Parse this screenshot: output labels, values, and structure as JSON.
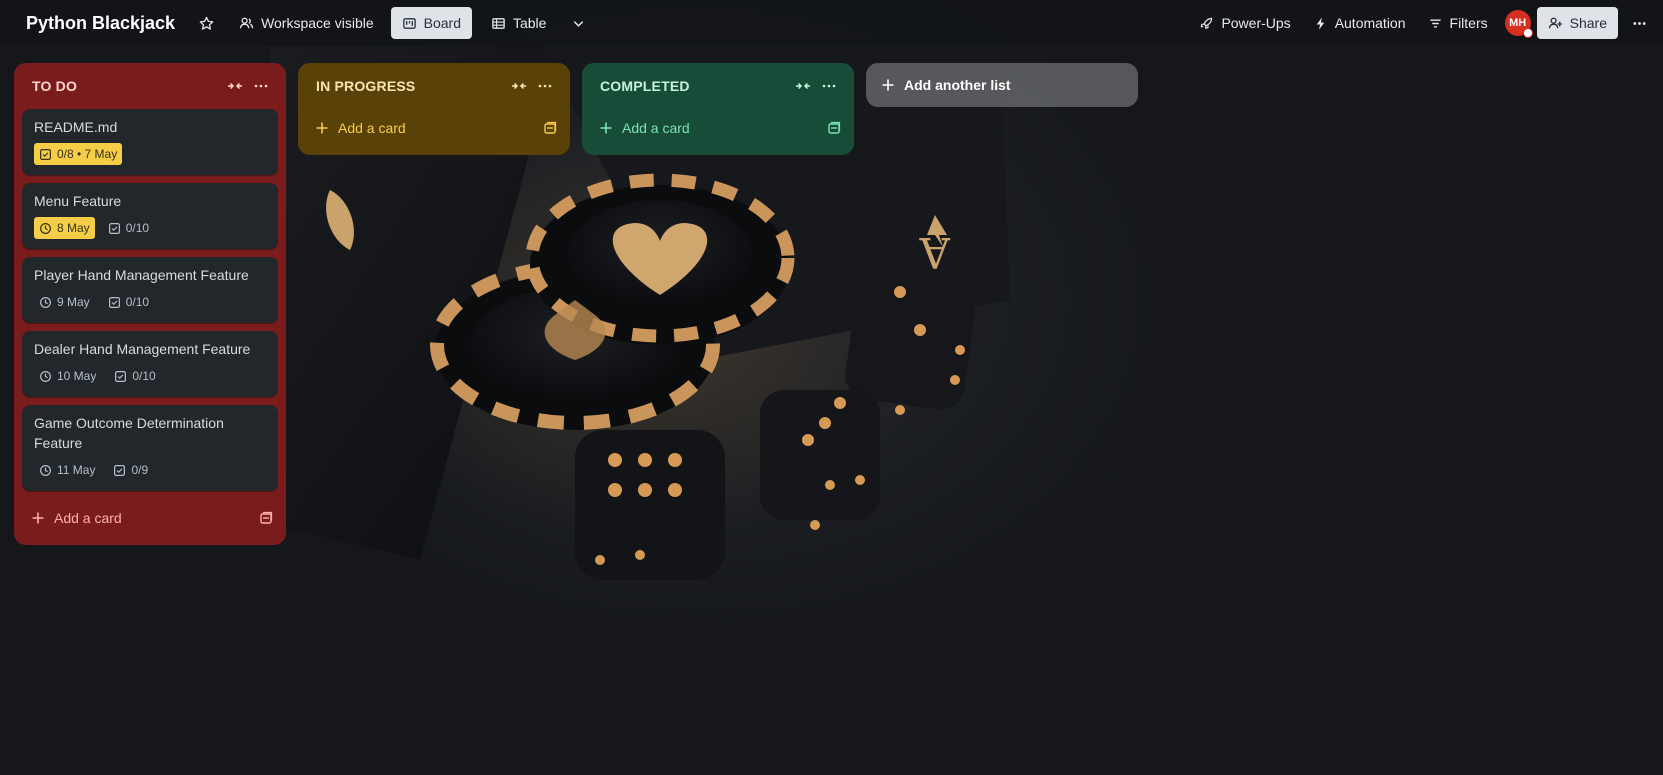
{
  "header": {
    "board_title": "Python Blackjack",
    "visibility_label": "Workspace visible",
    "views": [
      {
        "label": "Board",
        "icon": "board-icon",
        "active": true
      },
      {
        "label": "Table",
        "icon": "table-icon",
        "active": false
      }
    ],
    "power_ups_label": "Power-Ups",
    "automation_label": "Automation",
    "filters_label": "Filters",
    "avatar_initials": "MH",
    "share_label": "Share"
  },
  "lists": [
    {
      "title": "TO DO",
      "color": "#7b1c1c",
      "cards": [
        {
          "title": "README.md",
          "badges": [
            {
              "type": "checklist-date",
              "text": "0/8 • 7 May",
              "highlight": true
            }
          ]
        },
        {
          "title": "Menu Feature",
          "badges": [
            {
              "type": "date",
              "text": "8 May",
              "highlight": true
            },
            {
              "type": "checklist",
              "text": "0/10"
            }
          ]
        },
        {
          "title": "Player Hand Management Feature",
          "badges": [
            {
              "type": "date",
              "text": "9 May"
            },
            {
              "type": "checklist",
              "text": "0/10"
            }
          ]
        },
        {
          "title": "Dealer Hand Management Feature",
          "badges": [
            {
              "type": "date",
              "text": "10 May"
            },
            {
              "type": "checklist",
              "text": "0/10"
            }
          ]
        },
        {
          "title": "Game Outcome Determination Feature",
          "badges": [
            {
              "type": "date",
              "text": "11 May"
            },
            {
              "type": "checklist",
              "text": "0/9"
            }
          ]
        }
      ],
      "add_label": "Add a card"
    },
    {
      "title": "IN PROGRESS",
      "color": "#5a4107",
      "cards": [],
      "add_label": "Add a card"
    },
    {
      "title": "COMPLETED",
      "color": "#174d38",
      "cards": [],
      "add_label": "Add a card"
    }
  ],
  "add_list_label": "Add another list",
  "colors": {
    "date_highlight": "#f5cd47",
    "header_button": "#dfe3e8"
  }
}
